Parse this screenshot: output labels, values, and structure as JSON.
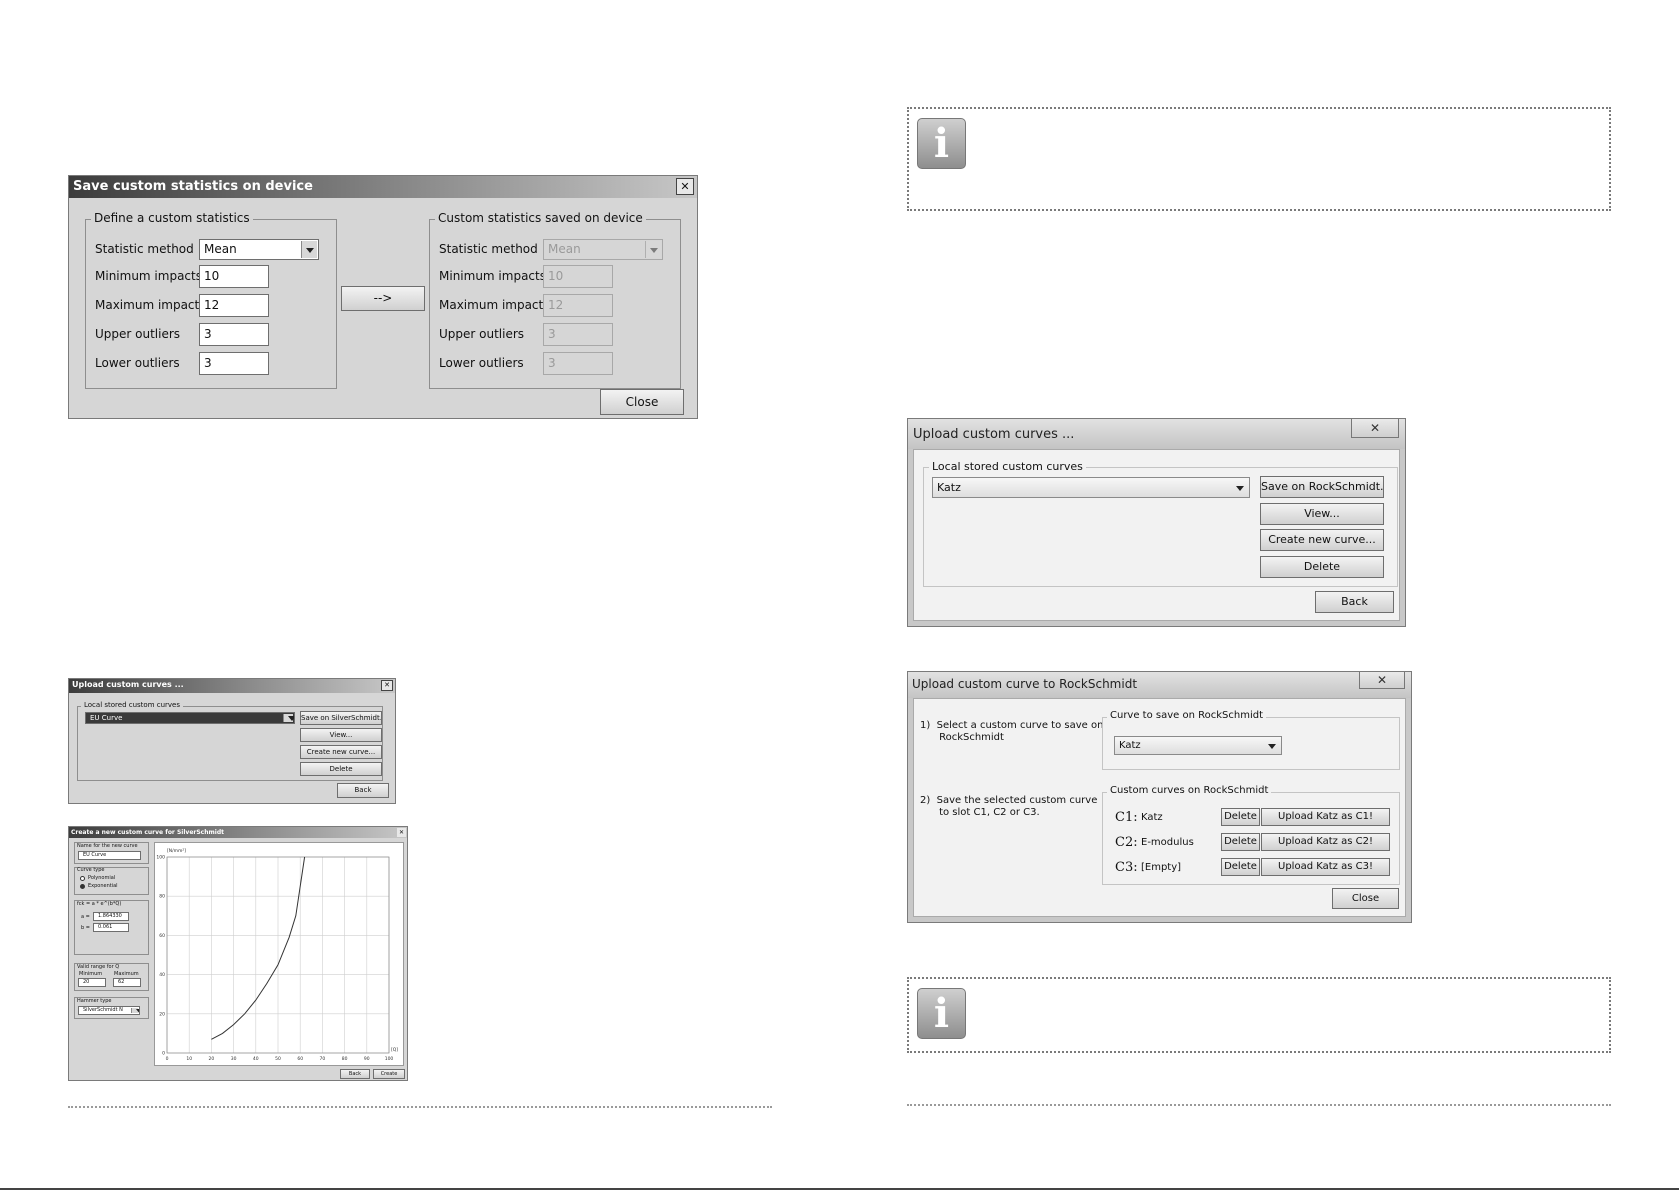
{
  "stats_dialog": {
    "title": "Save custom statistics on device",
    "close_x": "✕",
    "left_group": "Define a custom statistics",
    "right_group": "Custom statistics saved on device",
    "labels": [
      "Statistic method",
      "Minimum impacts",
      "Maximum impacts",
      "Upper outliers",
      "Lower outliers"
    ],
    "left_values": [
      "Mean",
      "10",
      "12",
      "3",
      "3"
    ],
    "right_values": [
      "Mean",
      "10",
      "12",
      "3",
      "3"
    ],
    "arrow_button": "-->",
    "close_button": "Close"
  },
  "small_upload": {
    "title": "Upload custom curves ...",
    "close_x": "✕",
    "group": "Local stored custom curves",
    "selected": "EU Curve",
    "buttons": [
      "Save on SilverSchmidt...",
      "View...",
      "Create new curve...",
      "Delete"
    ],
    "back": "Back"
  },
  "curve_creator": {
    "title": "Create a new custom curve for SilverSchmidt",
    "name_label": "Name for the new curve",
    "name_value": "EU Curve",
    "type_label": "Curve type",
    "type_options": [
      "Polynomial",
      "Exponential"
    ],
    "formula_label": "fck = a * e^(b*Q)",
    "a_label": "a =",
    "a_value": "1.864330",
    "b_label": "b =",
    "b_value": "0.061",
    "range_label": "Valid range for Q",
    "min_label": "Minimum",
    "max_label": "Maximum",
    "min_value": "20",
    "max_value": "62",
    "hammer_label": "Hammer type",
    "hammer_value": "SilverSchmidt N",
    "ylabel": "[N/mm²]",
    "xlabel": "[Q]",
    "back": "Back",
    "create": "Create"
  },
  "chart_data": {
    "type": "line",
    "title": "",
    "xlabel": "[Q]",
    "ylabel": "[N/mm²]",
    "xlim": [
      0,
      100
    ],
    "ylim": [
      0,
      100
    ],
    "x_ticks": [
      0,
      10,
      20,
      30,
      40,
      50,
      60,
      70,
      80,
      90,
      100
    ],
    "y_ticks": [
      0,
      20,
      40,
      60,
      80,
      100
    ],
    "grid": true,
    "series": [
      {
        "x": [
          20,
          25,
          30,
          35,
          40,
          45,
          50,
          55,
          58,
          62
        ],
        "y": [
          7,
          10,
          14.5,
          20,
          27,
          35.5,
          45,
          59,
          70,
          100
        ]
      }
    ]
  },
  "upload_curves": {
    "title": "Upload custom curves ...",
    "close_x": "✕",
    "group": "Local stored custom curves",
    "selected": "Katz",
    "buttons": [
      "Save on RockSchmidt...",
      "View...",
      "Create new curve...",
      "Delete"
    ],
    "back": "Back"
  },
  "upload_rs": {
    "title": "Upload custom curve to RockSchmidt",
    "close_x": "✕",
    "step1": "1)  Select a custom curve to save on\n      RockSchmidt",
    "step2": "2)  Save the selected custom curve\n      to slot C1, C2 or C3.",
    "group1": "Curve to save on RockSchmidt",
    "selected": "Katz",
    "group2": "Custom curves on RockSchmidt",
    "slots": [
      {
        "id": "C1:",
        "name": "Katz",
        "delete": "Delete",
        "upload": "Upload Katz as C1!"
      },
      {
        "id": "C2:",
        "name": "E-modulus",
        "delete": "Delete",
        "upload": "Upload Katz as C2!"
      },
      {
        "id": "C3:",
        "name": "[Empty]",
        "delete": "Delete",
        "upload": "Upload Katz as C3!"
      }
    ],
    "close": "Close"
  },
  "info_icon_glyph": "i",
  "colors": {
    "title_dark": "#3c3c3c",
    "dialog_bg": "#d6d6d6",
    "dotted": "#7a7a7a"
  }
}
